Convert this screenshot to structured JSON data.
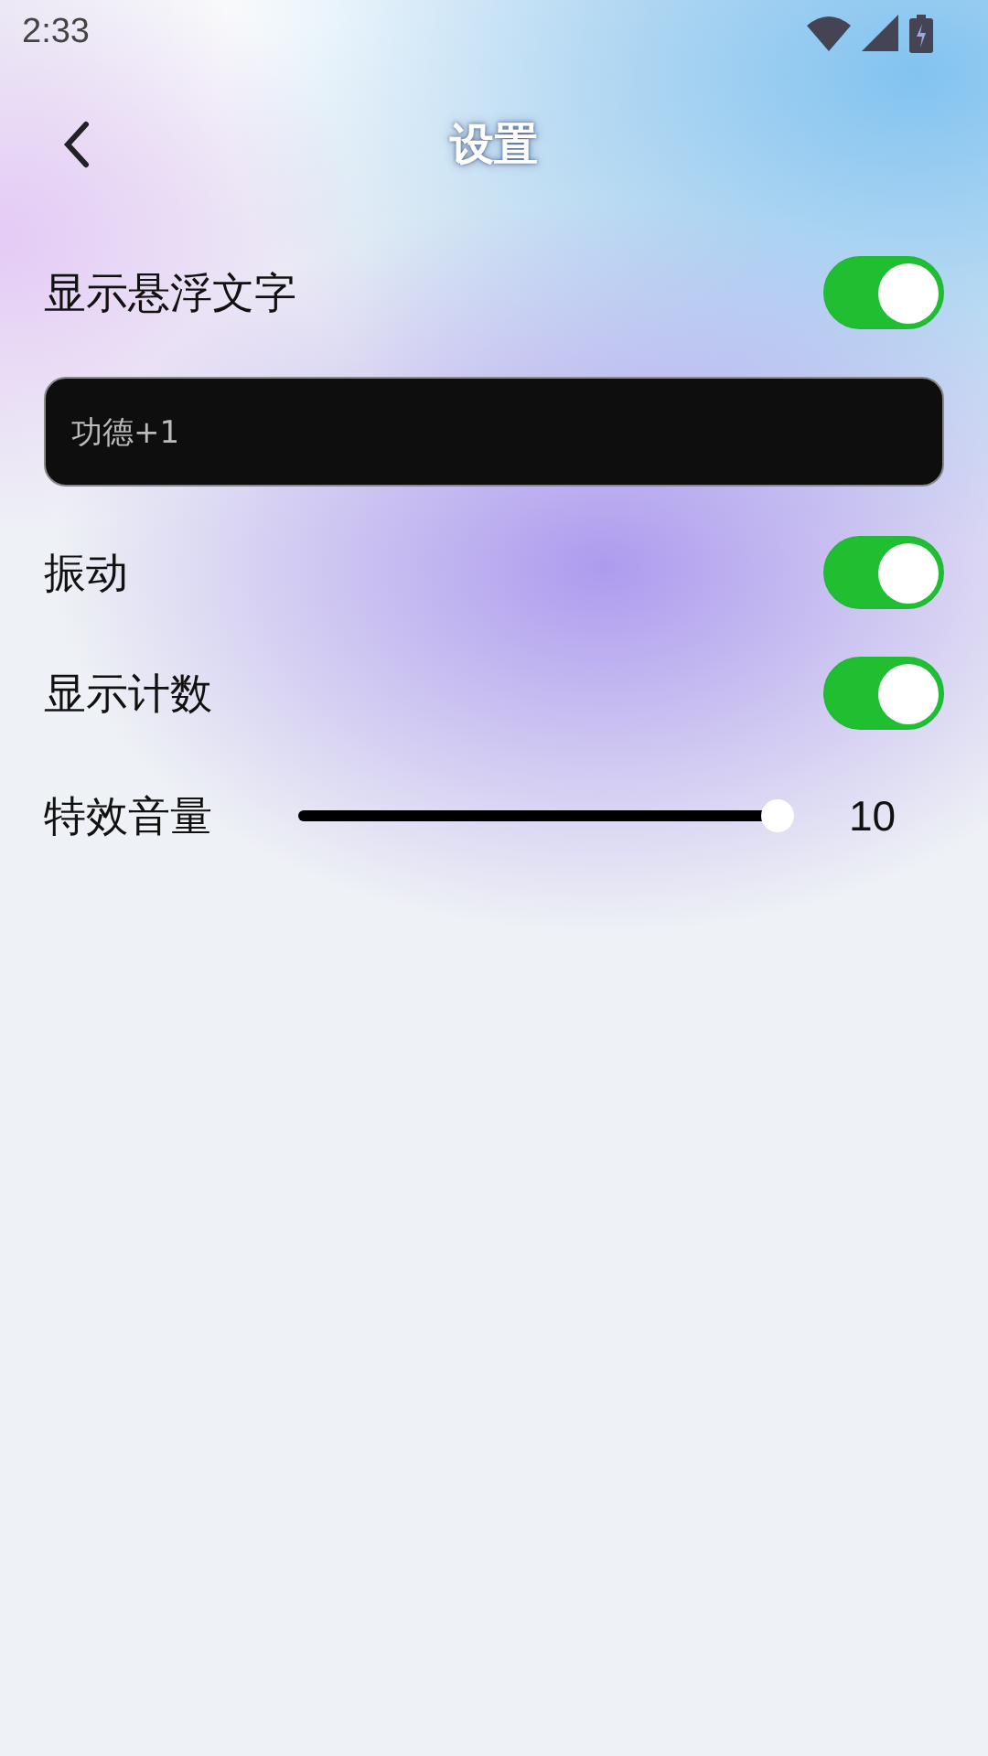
{
  "status_bar": {
    "time": "2:33"
  },
  "header": {
    "title": "设置"
  },
  "settings": [
    {
      "kind": "toggle",
      "label": "显示悬浮文字",
      "on": true
    },
    {
      "kind": "text_field",
      "value": "功德+1"
    },
    {
      "kind": "toggle",
      "label": "振动",
      "on": true
    },
    {
      "kind": "toggle",
      "label": "显示计数",
      "on": true
    },
    {
      "kind": "slider",
      "label": "特效音量",
      "level": 1,
      "reading": "10"
    }
  ]
}
